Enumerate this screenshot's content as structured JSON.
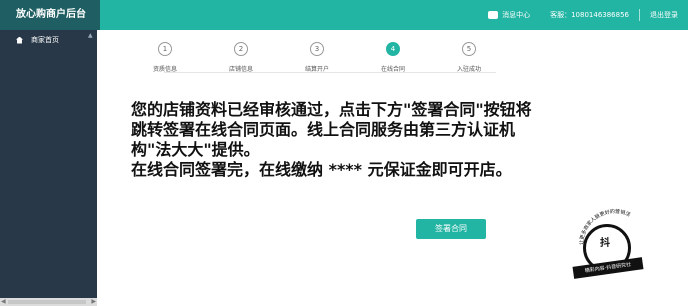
{
  "header": {
    "brand": "放心购商户后台",
    "message_center_label": "消息中心",
    "phone_label": "客服：",
    "phone_value": "1080146386856",
    "logout_label": "退出登录"
  },
  "sidebar": {
    "items": [
      {
        "label": "商家首页"
      }
    ]
  },
  "steps": [
    {
      "number": "1",
      "label": "资质信息"
    },
    {
      "number": "2",
      "label": "店铺信息"
    },
    {
      "number": "3",
      "label": "结算开户"
    },
    {
      "number": "4",
      "label": "在线合同"
    },
    {
      "number": "5",
      "label": "入驻成功"
    }
  ],
  "main": {
    "lines": [
      "您的店铺资料已经审核通过，点击下方\"签署合同\"按钮将",
      "跳转签署在线合同页面。线上合同服务由第三方认证机",
      "构\"法大大\"提供。",
      "在线合同签署完，在线缴纳   ****   元保证金即可开店。"
    ]
  },
  "buttons": {
    "sign_contract": "签署合同"
  },
  "watermark": {
    "center": "抖",
    "ribbon": "精彩内容·抖音研究社",
    "ring": "让更多商家人脉更好的营销活"
  },
  "colors": {
    "accent": "#22b5a3",
    "brand_bg": "#1f5f63",
    "sidebar_bg": "#283848"
  }
}
